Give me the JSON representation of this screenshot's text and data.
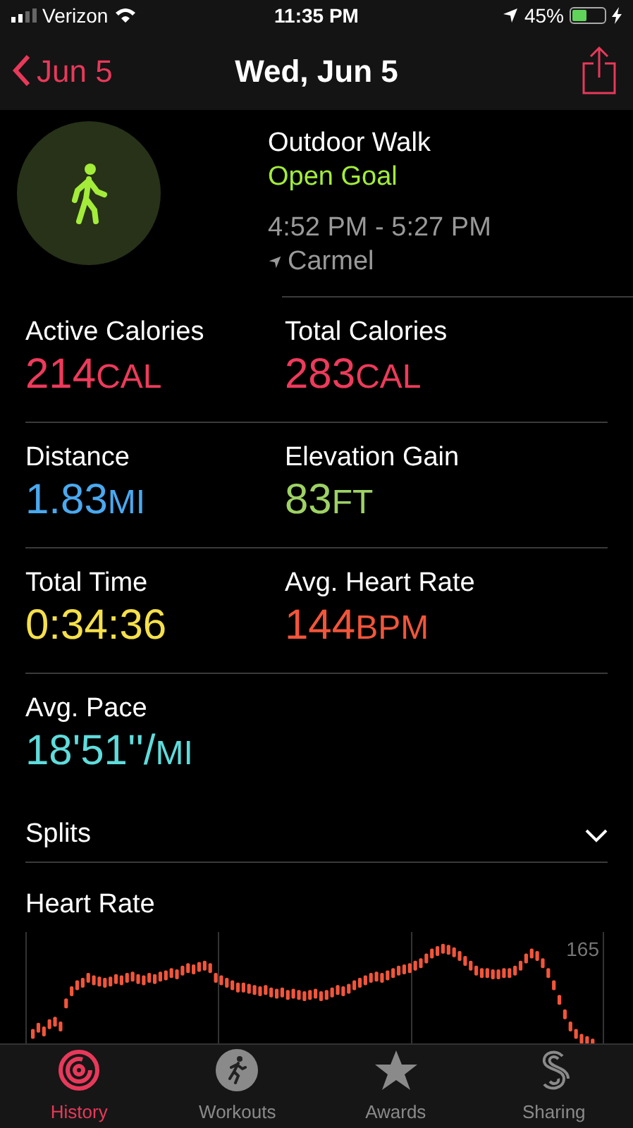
{
  "status_bar": {
    "carrier": "Verizon",
    "time": "11:35 PM",
    "battery": "45%"
  },
  "nav": {
    "back": "Jun 5",
    "title": "Wed, Jun 5"
  },
  "workout": {
    "name": "Outdoor Walk",
    "goal": "Open Goal",
    "time_range": "4:52 PM - 5:27 PM",
    "location": "Carmel"
  },
  "metrics": [
    {
      "label": "Active Calories",
      "value": "214",
      "unit": "CAL",
      "color": "#ee3a5b"
    },
    {
      "label": "Total Calories",
      "value": "283",
      "unit": "CAL",
      "color": "#ee3a5b"
    },
    {
      "label": "Distance",
      "value": "1.83",
      "unit": "MI",
      "color": "#4aa9f0"
    },
    {
      "label": "Elevation Gain",
      "value": "83",
      "unit": "FT",
      "color": "#9ed264"
    },
    {
      "label": "Total Time",
      "value": "0:34:36",
      "color": "#f5e04a"
    },
    {
      "label": "Avg. Heart Rate",
      "value": "144",
      "unit": "BPM",
      "color": "#f2553a"
    },
    {
      "label": "Avg. Pace",
      "value": "18'51''/",
      "unit": "MI",
      "color": "#5fdcdc"
    }
  ],
  "splits": {
    "label": "Splits",
    "expanded": false
  },
  "heart_rate": {
    "title": "Heart Rate",
    "max_label": "165"
  },
  "tabs": [
    {
      "label": "History",
      "selected": true
    },
    {
      "label": "Workouts",
      "selected": false
    },
    {
      "label": "Awards",
      "selected": false
    },
    {
      "label": "Sharing",
      "selected": false
    }
  ]
}
